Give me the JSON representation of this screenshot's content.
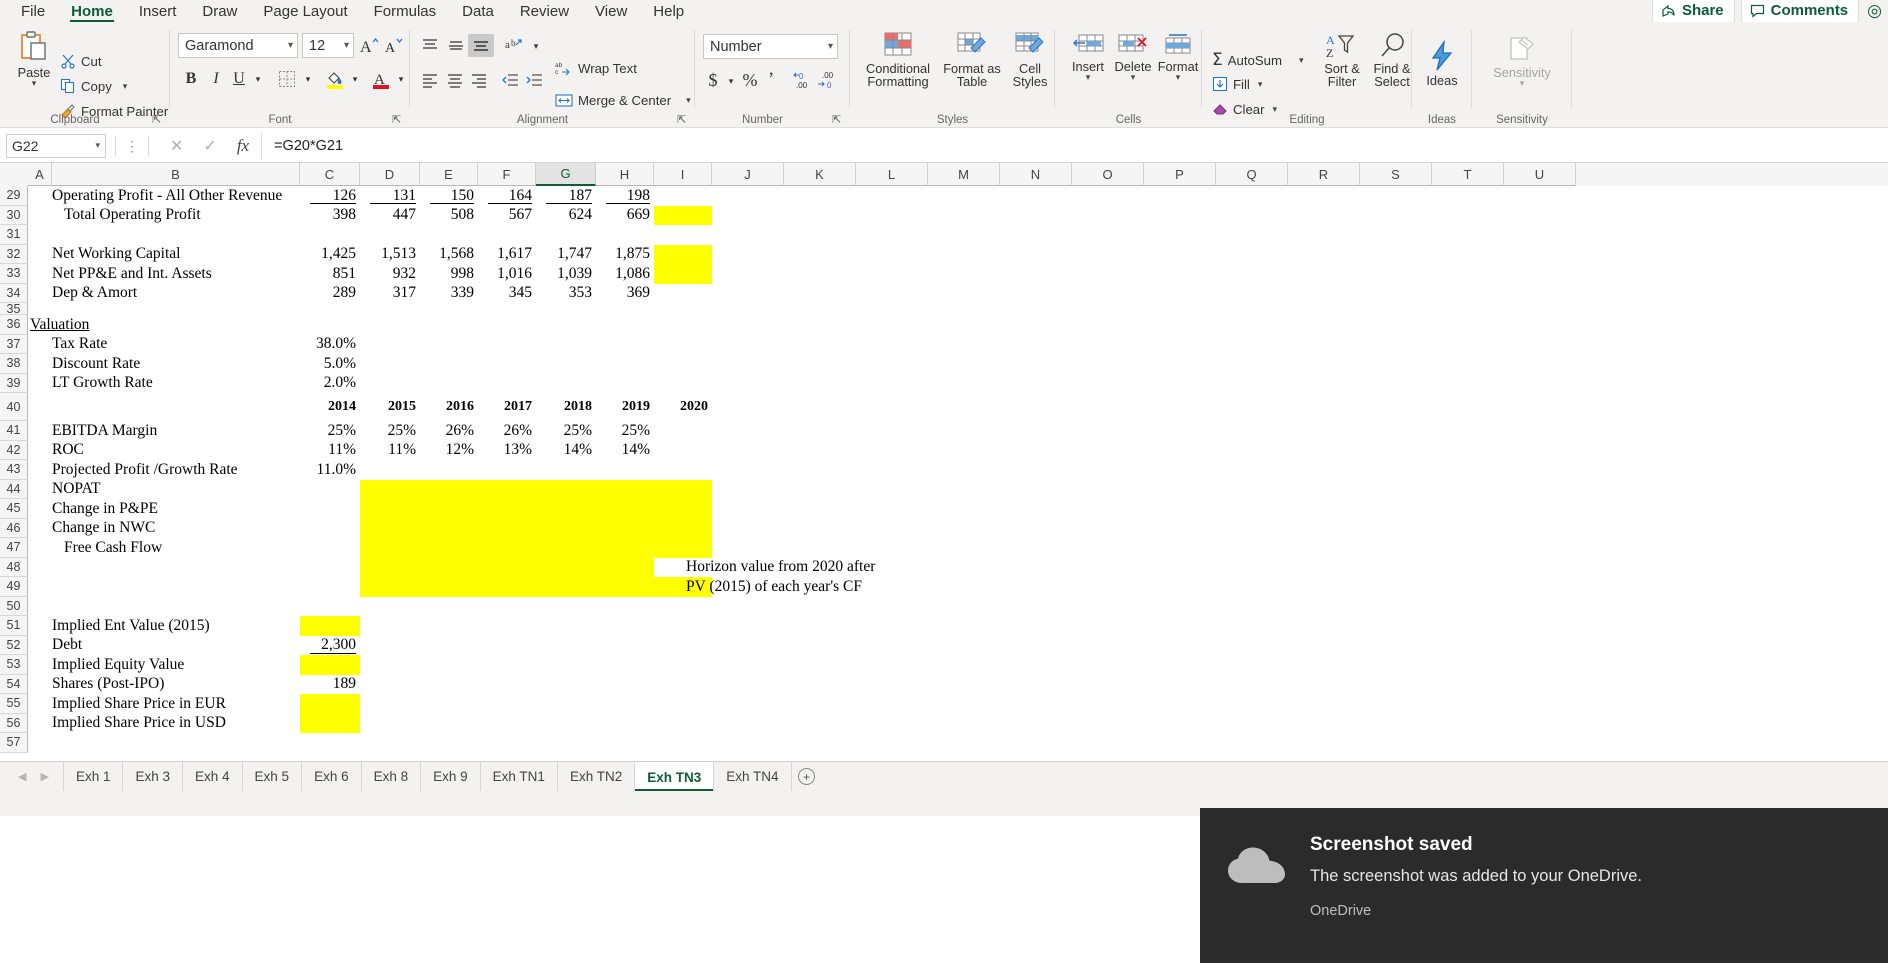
{
  "ribbon": {
    "tabs": [
      {
        "label": "File",
        "active": false
      },
      {
        "label": "Home",
        "active": true
      },
      {
        "label": "Insert",
        "active": false
      },
      {
        "label": "Draw",
        "active": false
      },
      {
        "label": "Page Layout",
        "active": false
      },
      {
        "label": "Formulas",
        "active": false
      },
      {
        "label": "Data",
        "active": false
      },
      {
        "label": "Review",
        "active": false
      },
      {
        "label": "View",
        "active": false
      },
      {
        "label": "Help",
        "active": false
      }
    ],
    "share_label": "Share",
    "comments_label": "Comments",
    "groups": {
      "clipboard": {
        "label": "Clipboard",
        "paste": "Paste",
        "cut": "Cut",
        "copy": "Copy",
        "format_painter": "Format Painter"
      },
      "font": {
        "label": "Font",
        "font_family": "Garamond",
        "font_size": "12"
      },
      "alignment": {
        "label": "Alignment",
        "wrap_text": "Wrap Text",
        "merge_center": "Merge & Center"
      },
      "number": {
        "label": "Number",
        "format": "Number"
      },
      "styles": {
        "label": "Styles",
        "conditional_formatting": "Conditional Formatting",
        "format_as_table": "Format as Table",
        "cell_styles": "Cell Styles"
      },
      "cells": {
        "label": "Cells",
        "insert": "Insert",
        "delete": "Delete",
        "format": "Format"
      },
      "editing": {
        "label": "Editing",
        "autosum": "AutoSum",
        "fill": "Fill",
        "clear": "Clear",
        "sort_filter": "Sort & Filter",
        "find_select": "Find & Select"
      },
      "ideas": {
        "label": "Ideas",
        "ideas": "Ideas"
      },
      "sensitivity": {
        "label": "Sensitivity",
        "sensitivity": "Sensitivity"
      }
    }
  },
  "formula_bar": {
    "name_box": "G22",
    "formula": "=G20*G21"
  },
  "grid": {
    "columns": [
      "A",
      "B",
      "C",
      "D",
      "E",
      "F",
      "G",
      "H",
      "I",
      "J",
      "K",
      "L",
      "M",
      "N",
      "O",
      "P",
      "Q",
      "R",
      "S",
      "T",
      "U"
    ],
    "active_column": "G",
    "rows": [
      "29",
      "30",
      "31",
      "32",
      "33",
      "34",
      "35",
      "36",
      "37",
      "38",
      "39",
      "40",
      "41",
      "42",
      "43",
      "44",
      "45",
      "46",
      "47",
      "48",
      "49",
      "50",
      "51",
      "52",
      "53",
      "54",
      "55",
      "56",
      "57"
    ],
    "data": [
      {
        "row": "29",
        "label": "Operating Profit - All Other Revenue",
        "indent": 0,
        "values": [
          "126",
          "131",
          "150",
          "164",
          "187",
          "198"
        ],
        "value_style": "underline"
      },
      {
        "row": "30",
        "label": "Total Operating Profit",
        "indent": 1,
        "values": [
          "398",
          "447",
          "508",
          "567",
          "624",
          "669"
        ],
        "value_style": "plain"
      },
      {
        "row": "31",
        "label": "",
        "indent": 0,
        "values": [],
        "value_style": "plain"
      },
      {
        "row": "32",
        "label": "Net Working Capital",
        "indent": 0,
        "values": [
          "1,425",
          "1,513",
          "1,568",
          "1,617",
          "1,747",
          "1,875"
        ],
        "value_style": "plain"
      },
      {
        "row": "33",
        "label": "Net PP&E and Int. Assets",
        "indent": 0,
        "values": [
          "851",
          "932",
          "998",
          "1,016",
          "1,039",
          "1,086"
        ],
        "value_style": "plain"
      },
      {
        "row": "34",
        "label": "Dep & Amort",
        "indent": 0,
        "values": [
          "289",
          "317",
          "339",
          "345",
          "353",
          "369"
        ],
        "value_style": "plain"
      },
      {
        "row": "35",
        "label": "",
        "indent": 0,
        "values": [],
        "value_style": "plain"
      },
      {
        "row": "36",
        "label": "Valuation",
        "indent": -1,
        "values": [],
        "value_style": "plain",
        "label_style": "underline"
      },
      {
        "row": "37",
        "label": "Tax Rate",
        "indent": 0,
        "values": [
          "38.0%"
        ],
        "value_style": "plain"
      },
      {
        "row": "38",
        "label": "Discount Rate",
        "indent": 0,
        "values": [
          "5.0%"
        ],
        "value_style": "plain"
      },
      {
        "row": "39",
        "label": "LT Growth Rate",
        "indent": 0,
        "values": [
          "2.0%"
        ],
        "value_style": "plain"
      },
      {
        "row": "40",
        "label": "",
        "indent": 0,
        "values": [
          "2014",
          "2015",
          "2016",
          "2017",
          "2018",
          "2019",
          "2020"
        ],
        "value_style": "bold"
      },
      {
        "row": "41",
        "label": "EBITDA Margin",
        "indent": 0,
        "values": [
          "25%",
          "25%",
          "26%",
          "26%",
          "25%",
          "25%"
        ],
        "value_style": "plain"
      },
      {
        "row": "42",
        "label": "ROC",
        "indent": 0,
        "values": [
          "11%",
          "11%",
          "12%",
          "13%",
          "14%",
          "14%"
        ],
        "value_style": "plain"
      },
      {
        "row": "43",
        "label": "Projected Profit /Growth Rate",
        "indent": 0,
        "values": [
          "11.0%"
        ],
        "value_style": "plain"
      },
      {
        "row": "44",
        "label": "NOPAT",
        "indent": 0,
        "values": [],
        "value_style": "plain"
      },
      {
        "row": "45",
        "label": "Change in P&PE",
        "indent": 0,
        "values": [],
        "value_style": "plain"
      },
      {
        "row": "46",
        "label": "Change in NWC",
        "indent": 0,
        "values": [],
        "value_style": "plain"
      },
      {
        "row": "47",
        "label": "Free Cash Flow",
        "indent": 1,
        "values": [],
        "value_style": "plain"
      },
      {
        "row": "48",
        "label": "",
        "indent": 0,
        "values": [],
        "value_style": "plain"
      },
      {
        "row": "49",
        "label": "",
        "indent": 0,
        "values": [],
        "value_style": "plain"
      },
      {
        "row": "50",
        "label": "",
        "indent": 0,
        "values": [],
        "value_style": "plain"
      },
      {
        "row": "51",
        "label": "Implied Ent Value (2015)",
        "indent": 0,
        "values": [],
        "value_style": "plain"
      },
      {
        "row": "52",
        "label": "Debt",
        "indent": 0,
        "values": [
          "2,300"
        ],
        "value_style": "plain"
      },
      {
        "row": "53",
        "label": "Implied Equity Value",
        "indent": 0,
        "values": [],
        "value_style": "plain"
      },
      {
        "row": "54",
        "label": "Shares (Post-IPO)",
        "indent": 0,
        "values": [
          "189"
        ],
        "value_style": "plain"
      },
      {
        "row": "55",
        "label": "Implied Share Price in EUR",
        "indent": 0,
        "values": [],
        "value_style": "plain"
      },
      {
        "row": "56",
        "label": "Implied Share Price in USD",
        "indent": 0,
        "values": [],
        "value_style": "plain"
      },
      {
        "row": "57",
        "label": "",
        "indent": 0,
        "values": [],
        "value_style": "plain"
      }
    ],
    "annotations": [
      {
        "row": "48",
        "text": "Horizon value from 2020 after"
      },
      {
        "row": "49",
        "text": "PV (2015) of each year's CF"
      }
    ],
    "highlight_color": "#ffff00"
  },
  "sheet_tabs": {
    "tabs": [
      {
        "label": "Exh 1",
        "active": false
      },
      {
        "label": "Exh 3",
        "active": false
      },
      {
        "label": "Exh 4",
        "active": false
      },
      {
        "label": "Exh 5",
        "active": false
      },
      {
        "label": "Exh 6",
        "active": false
      },
      {
        "label": "Exh 8",
        "active": false
      },
      {
        "label": "Exh 9",
        "active": false
      },
      {
        "label": "Exh TN1",
        "active": false
      },
      {
        "label": "Exh TN2",
        "active": false
      },
      {
        "label": "Exh TN3",
        "active": true
      },
      {
        "label": "Exh TN4",
        "active": false
      }
    ],
    "add_label": "+"
  },
  "toast": {
    "title": "Screenshot saved",
    "text": "The screenshot was added to your OneDrive.",
    "source": "OneDrive"
  }
}
